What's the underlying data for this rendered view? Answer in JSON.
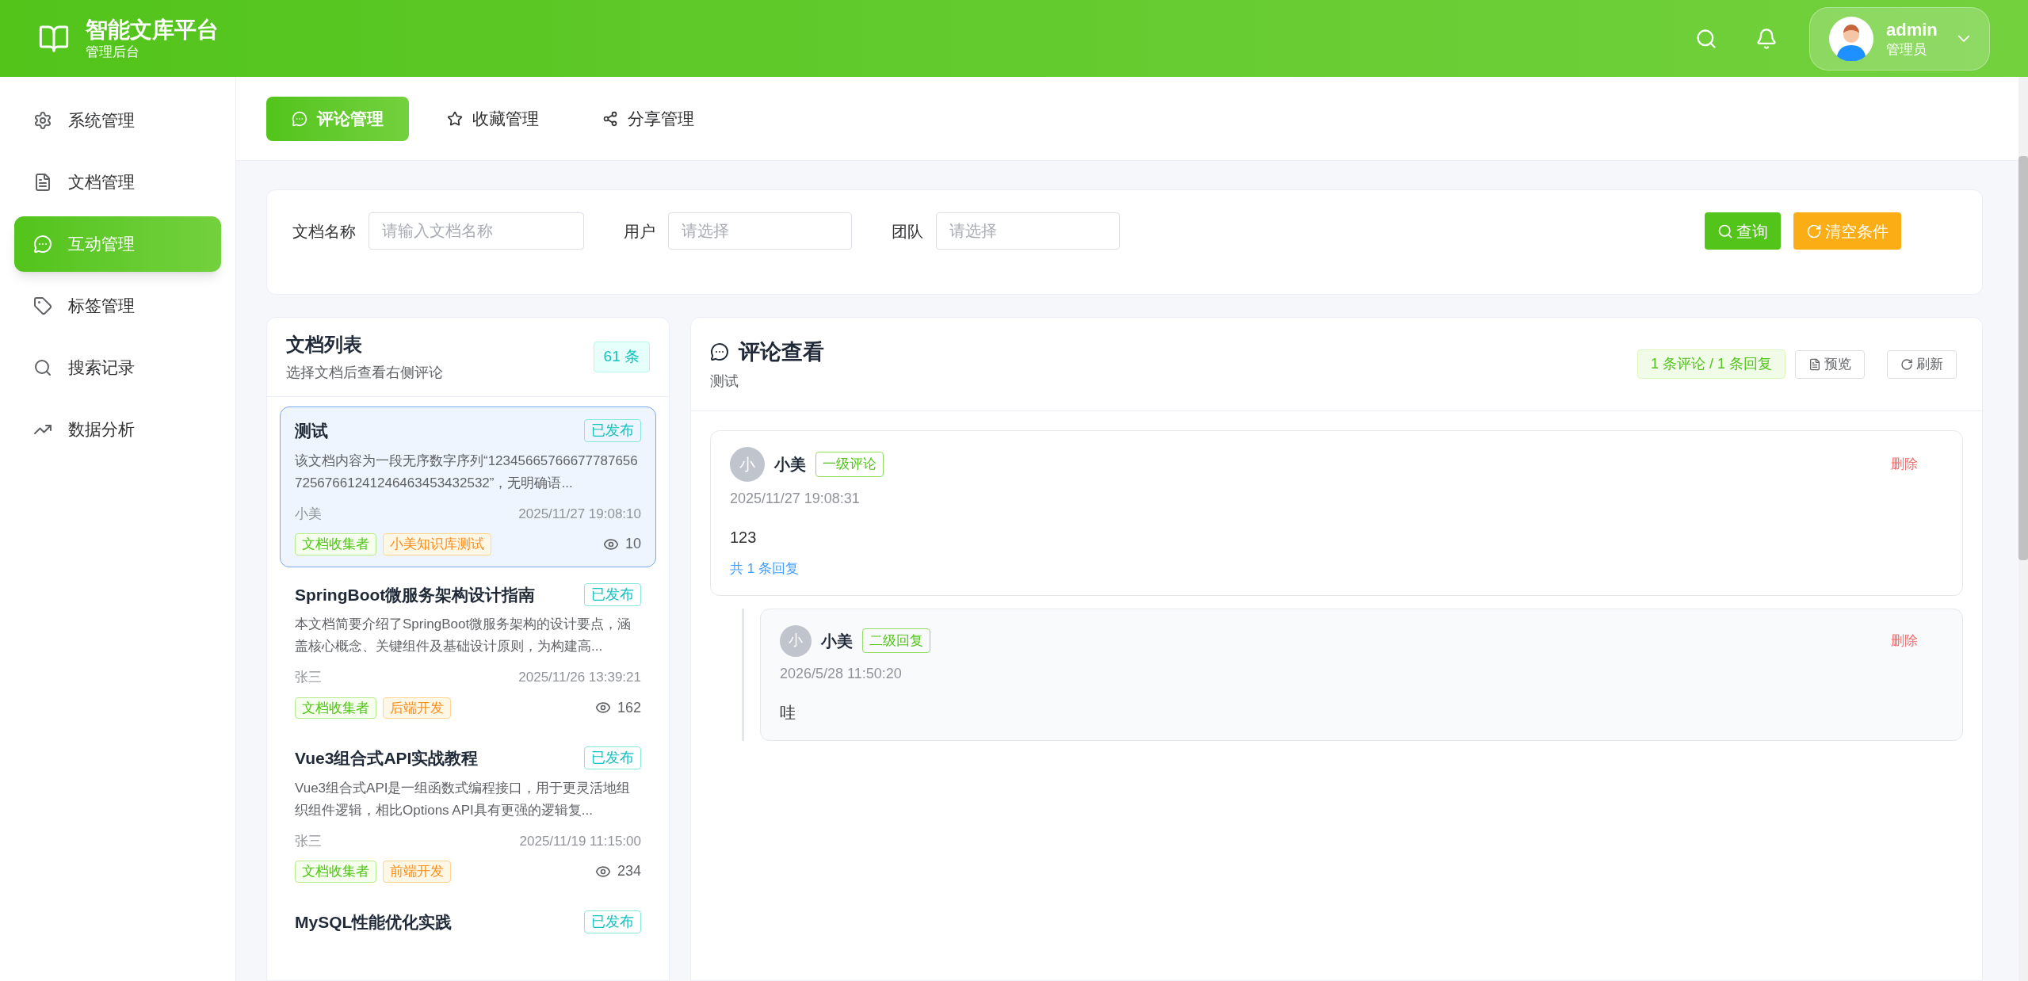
{
  "header": {
    "title": "智能文库平台",
    "subtitle": "管理后台",
    "user": {
      "name": "admin",
      "role": "管理员"
    }
  },
  "sidebar": {
    "items": [
      {
        "label": "系统管理",
        "selected": false
      },
      {
        "label": "文档管理",
        "selected": false
      },
      {
        "label": "互动管理",
        "selected": true
      },
      {
        "label": "标签管理",
        "selected": false
      },
      {
        "label": "搜索记录",
        "selected": false
      },
      {
        "label": "数据分析",
        "selected": false
      }
    ]
  },
  "tabs": [
    {
      "label": "评论管理",
      "selected": true
    },
    {
      "label": "收藏管理",
      "selected": false
    },
    {
      "label": "分享管理",
      "selected": false
    }
  ],
  "filters": {
    "fields": [
      {
        "label": "文档名称",
        "placeholder": "请输入文档名称"
      },
      {
        "label": "用户",
        "placeholder": "请选择"
      },
      {
        "label": "团队",
        "placeholder": "请选择"
      }
    ],
    "buttons": [
      {
        "label": "查询",
        "kind": "primary"
      },
      {
        "label": "清空条件",
        "kind": "warning"
      }
    ]
  },
  "doc_list": {
    "title": "文档列表",
    "subtitle": "选择文档后查看右侧评论",
    "count": "61 条",
    "items": [
      {
        "title": "测试",
        "status": "已发布",
        "summary": "该文档内容为一段无序数字序列“1234566576667778765672567661241246463453432532”，无明确语...",
        "author": "小美",
        "time": "2025/11/27 19:08:10",
        "tags": [
          "文档收集者",
          "小美知识库测试"
        ],
        "views": "10",
        "selected": true
      },
      {
        "title": "SpringBoot微服务架构设计指南",
        "status": "已发布",
        "summary": "本文档简要介绍了SpringBoot微服务架构的设计要点，涵盖核心概念、关键组件及基础设计原则，为构建高...",
        "author": "张三",
        "time": "2025/11/26 13:39:21",
        "tags": [
          "文档收集者",
          "后端开发"
        ],
        "views": "162",
        "selected": false
      },
      {
        "title": "Vue3组合式API实战教程",
        "status": "已发布",
        "summary": "Vue3组合式API是一组函数式编程接口，用于更灵活地组织组件逻辑，相比Options API具有更强的逻辑复...",
        "author": "张三",
        "time": "2025/11/19 11:15:00",
        "tags": [
          "文档收集者",
          "前端开发"
        ],
        "views": "234",
        "selected": false
      },
      {
        "title": "MySQL性能优化实践",
        "status": "已发布",
        "selected": false
      }
    ]
  },
  "comments": {
    "title": "评论查看",
    "subtitle": "测试",
    "stats": "1 条评论 / 1 条回复",
    "buttons": [
      {
        "label": "预览"
      },
      {
        "label": "刷新"
      }
    ],
    "items": [
      {
        "avatar_text": "小",
        "user": "小美",
        "level": "一级评论",
        "time": "2025/11/27 19:08:31",
        "content": "123",
        "reply_count": "共 1 条回复",
        "delete": "删除",
        "children": [
          {
            "avatar_text": "小",
            "user": "小美",
            "level": "二级回复",
            "time": "2026/5/28 11:50:20",
            "content": "哇",
            "delete": "删除"
          }
        ]
      }
    ]
  }
}
